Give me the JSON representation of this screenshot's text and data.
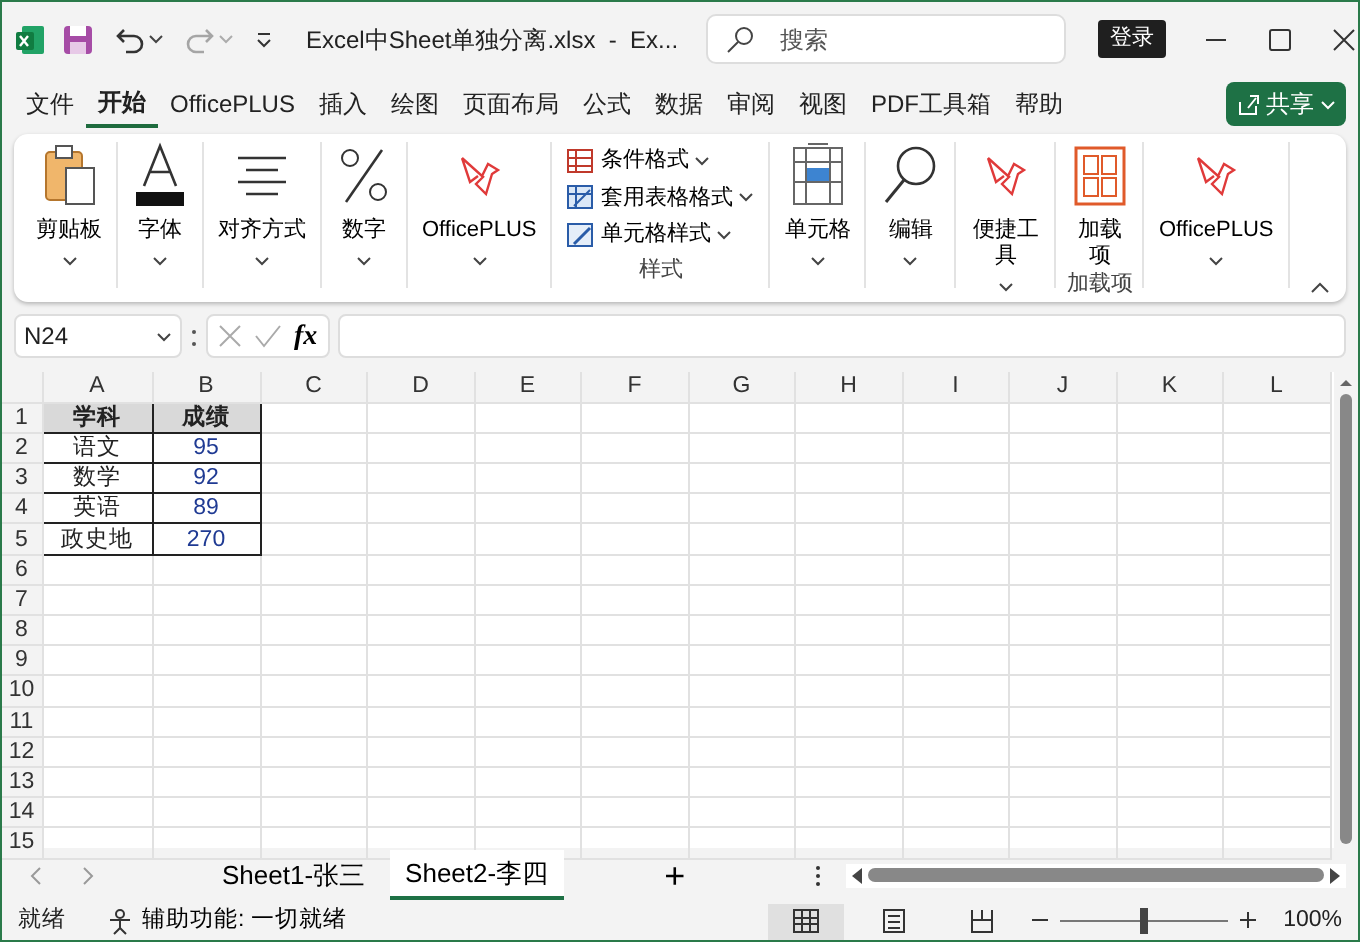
{
  "title_bar": {
    "quick_access": [
      {
        "kind": "save",
        "disabled": false
      },
      {
        "kind": "undo",
        "disabled": false
      },
      {
        "kind": "redo",
        "disabled": true
      },
      {
        "kind": "customize",
        "disabled": false
      }
    ],
    "title": "Excel中Sheet单独分离.xlsx  -  Ex...",
    "search": {
      "placeholder": "搜索"
    },
    "sign_in": "登录"
  },
  "menu_tabs": [
    {
      "label": "文件",
      "selected": false
    },
    {
      "label": "开始",
      "selected": true
    },
    {
      "label": "OfficePLUS",
      "selected": false
    },
    {
      "label": "插入",
      "selected": false
    },
    {
      "label": "绘图",
      "selected": false
    },
    {
      "label": "页面布局",
      "selected": false
    },
    {
      "label": "公式",
      "selected": false
    },
    {
      "label": "数据",
      "selected": false
    },
    {
      "label": "审阅",
      "selected": false
    },
    {
      "label": "视图",
      "selected": false
    },
    {
      "label": "PDF工具箱",
      "selected": false
    },
    {
      "label": "帮助",
      "selected": false
    }
  ],
  "share_button": "共享",
  "ribbon": [
    {
      "kind": "large",
      "label": "剪贴板"
    },
    {
      "kind": "large",
      "label": "字体"
    },
    {
      "kind": "large",
      "label": "对齐方式"
    },
    {
      "kind": "large",
      "label": "数字"
    },
    {
      "kind": "large",
      "label": "OfficePLUS"
    },
    {
      "kind": "stack",
      "items": [
        "条件格式",
        "套用表格格式",
        "单元格样式"
      ],
      "group_label": "样式"
    },
    {
      "kind": "large",
      "label": "单元格"
    },
    {
      "kind": "large",
      "label": "编辑"
    },
    {
      "kind": "large",
      "label": "便捷工具"
    },
    {
      "kind": "addin",
      "label": "加载项",
      "group_label": "加载项"
    },
    {
      "kind": "large",
      "label": "OfficePLUS"
    }
  ],
  "formula_bar": {
    "name_box": "N24",
    "fx": "fx"
  },
  "sheet": {
    "columns": [
      "A",
      "B",
      "C",
      "D",
      "E",
      "F",
      "G",
      "H",
      "I",
      "J",
      "K",
      "L"
    ],
    "rows": [
      {
        "number": "1",
        "kind": "header",
        "cells": [
          "学科",
          "成绩"
        ]
      },
      {
        "number": "2",
        "kind": "data",
        "cells": [
          "语文",
          "95"
        ]
      },
      {
        "number": "3",
        "kind": "data",
        "cells": [
          "数学",
          "92"
        ]
      },
      {
        "number": "4",
        "kind": "data",
        "cells": [
          "英语",
          "89"
        ]
      },
      {
        "number": "5",
        "kind": "data",
        "cells": [
          "政史地",
          "270"
        ]
      },
      {
        "number": "6",
        "kind": "blank"
      },
      {
        "number": "7",
        "kind": "blank"
      },
      {
        "number": "8",
        "kind": "blank"
      },
      {
        "number": "9",
        "kind": "blank"
      },
      {
        "number": "10",
        "kind": "blank"
      },
      {
        "number": "11",
        "kind": "blank"
      },
      {
        "number": "12",
        "kind": "blank"
      },
      {
        "number": "13",
        "kind": "blank"
      },
      {
        "number": "14",
        "kind": "blank"
      },
      {
        "number": "15",
        "kind": "blank"
      }
    ]
  },
  "sheet_tabs": [
    {
      "label": "Sheet1-张三",
      "selected": false
    },
    {
      "label": "Sheet2-李四",
      "selected": true
    }
  ],
  "add_sheet": "+",
  "status_bar": {
    "ready": "就绪",
    "accessibility": "辅助功能: 一切就绪",
    "views": [
      {
        "kind": "normal",
        "selected": true
      },
      {
        "kind": "page_layout",
        "selected": false
      },
      {
        "kind": "page_break",
        "selected": false
      }
    ],
    "zoom": {
      "level": 0.5
    },
    "zoom_text": "100%"
  }
}
